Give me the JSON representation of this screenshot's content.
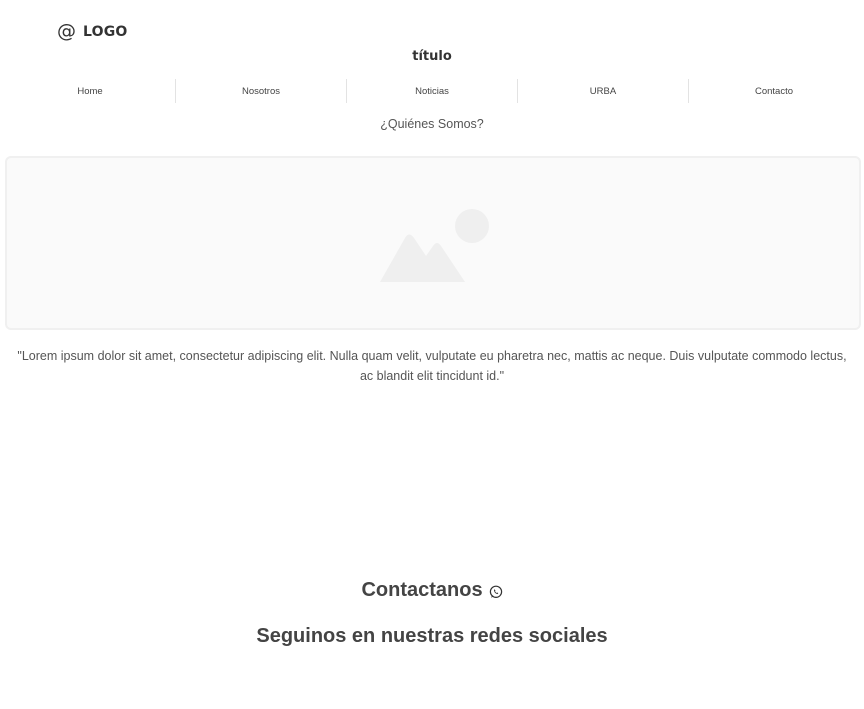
{
  "header": {
    "logo_symbol": "@",
    "logo_text": "LOGO",
    "title": "título"
  },
  "nav": {
    "items": [
      {
        "label": "Home"
      },
      {
        "label": "Nosotros"
      },
      {
        "label": "Noticias"
      },
      {
        "label": "URBA"
      },
      {
        "label": "Contacto"
      }
    ]
  },
  "main": {
    "section_heading": "¿Quiénes Somos?",
    "image_icon": "image-placeholder-icon",
    "quote": "\"Lorem ipsum dolor sit amet, consectetur adipiscing elit. Nulla quam velit, vulputate eu pharetra nec, mattis ac neque. Duis vulputate commodo lectus, ac blandit elit tincidunt id.\""
  },
  "footer": {
    "contact_label": "Contactanos",
    "contact_icon": "whatsapp-icon",
    "social_heading": "Seguinos en nuestras redes sociales"
  },
  "colors": {
    "text": "#444444",
    "divider": "#e3e3e3",
    "placeholder_bg": "#fafafa",
    "placeholder_icon": "#efefef"
  }
}
